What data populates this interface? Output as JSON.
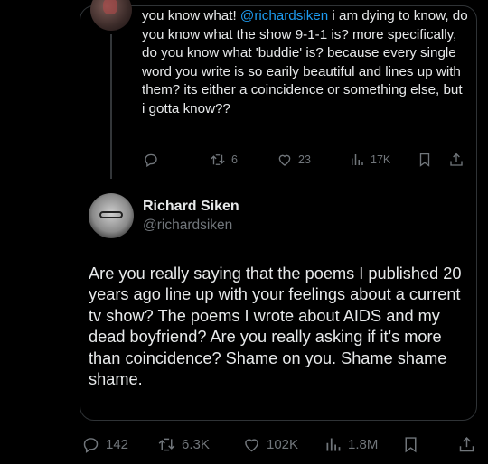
{
  "reply": {
    "text_before": "you know what! ",
    "mention": "@richardsiken",
    "text_after": " i am dying to know, do you know what the show 9-1-1 is? more specifically, do you know what 'buddie' is? because every single word you write is so earily beautiful and lines up with them? its either a coincidence or something else, but i gotta know??",
    "reply_count": "",
    "retweet_count": "6",
    "like_count": "23",
    "view_count": "17K"
  },
  "author": {
    "name": "Richard Siken",
    "handle": "@richardsiken"
  },
  "tweet": {
    "text": "Are you really saying that the poems I published 20 years ago line up with your feelings about a current tv show? The poems I wrote about AIDS and my dead boyfriend? Are you really asking if it's more than coincidence? Shame on you. Shame shame shame.",
    "reply_count": "142",
    "retweet_count": "6.3K",
    "like_count": "102K",
    "view_count": "1.8M"
  },
  "icons": [
    "reply-icon",
    "retweet-icon",
    "like-icon",
    "views-icon",
    "bookmark-icon",
    "share-icon"
  ]
}
